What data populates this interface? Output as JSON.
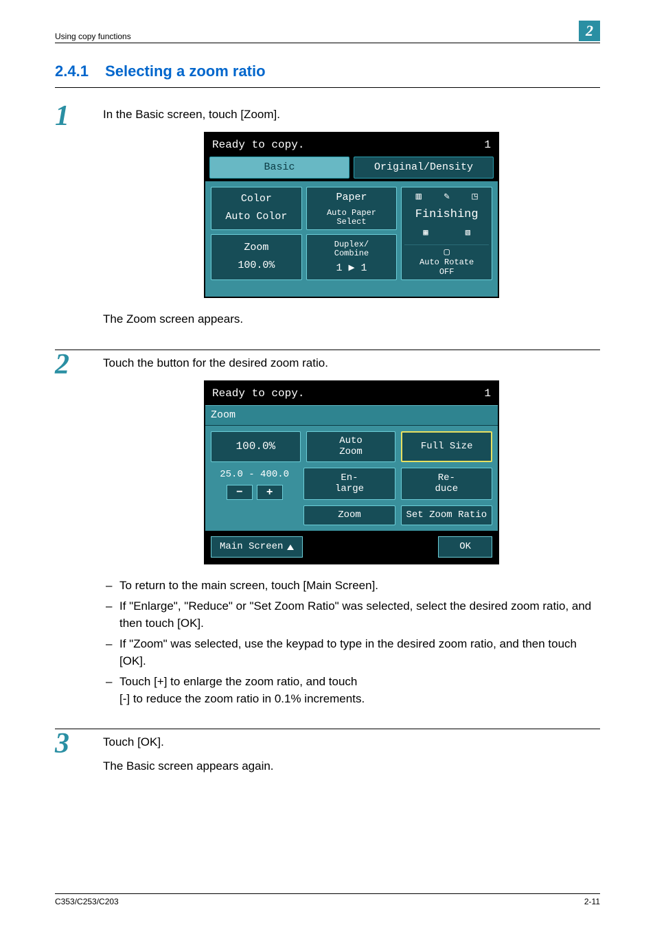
{
  "header": {
    "left": "Using copy functions",
    "badge": "2"
  },
  "section": {
    "number": "2.4.1",
    "title": "Selecting a zoom ratio"
  },
  "steps": {
    "s1": {
      "num": "1",
      "text": "In the Basic screen, touch [Zoom].",
      "after": "The Zoom screen appears."
    },
    "s2": {
      "num": "2",
      "text": "Touch the button for the desired zoom ratio.",
      "bullets": [
        "To return to the main screen, touch [Main Screen].",
        "If \"Enlarge\", \"Reduce\" or \"Set Zoom Ratio\" was selected, select the desired zoom ratio, and then touch [OK].",
        "If \"Zoom\" was selected, use the keypad to type in the desired zoom ratio, and then touch [OK].",
        "Touch [+] to enlarge the zoom ratio, and touch\n[-] to reduce the zoom ratio in 0.1% increments."
      ]
    },
    "s3": {
      "num": "3",
      "text": "Touch [OK].",
      "after": "The Basic screen appears again."
    }
  },
  "screen1": {
    "status": "Ready to copy.",
    "count": "1",
    "tabs": {
      "basic": "Basic",
      "orig": "Original/Density"
    },
    "color": {
      "label": "Color",
      "value": "Auto Color"
    },
    "paper": {
      "label": "Paper",
      "value": "Auto Paper\nSelect"
    },
    "zoom": {
      "label": "Zoom",
      "value": "100.0%"
    },
    "duplex": {
      "label": "Duplex/\nCombine",
      "value": "1 ▶ 1"
    },
    "finishing": {
      "label": "Finishing",
      "autorotate": "Auto Rotate\nOFF"
    }
  },
  "screen2": {
    "status": "Ready to copy.",
    "count": "1",
    "title": "Zoom",
    "current": "100.0%",
    "range": "25.0  -  400.0",
    "minus": "−",
    "plus": "+",
    "autozoom": "Auto\nZoom",
    "fullsize": "Full Size",
    "enlarge": "En-\nlarge",
    "reduce": "Re-\nduce",
    "zoombtn": "Zoom",
    "setzoom": "Set Zoom Ratio",
    "mainscreen": "Main Screen",
    "ok": "OK"
  },
  "footer": {
    "left": "C353/C253/C203",
    "right": "2-11"
  }
}
